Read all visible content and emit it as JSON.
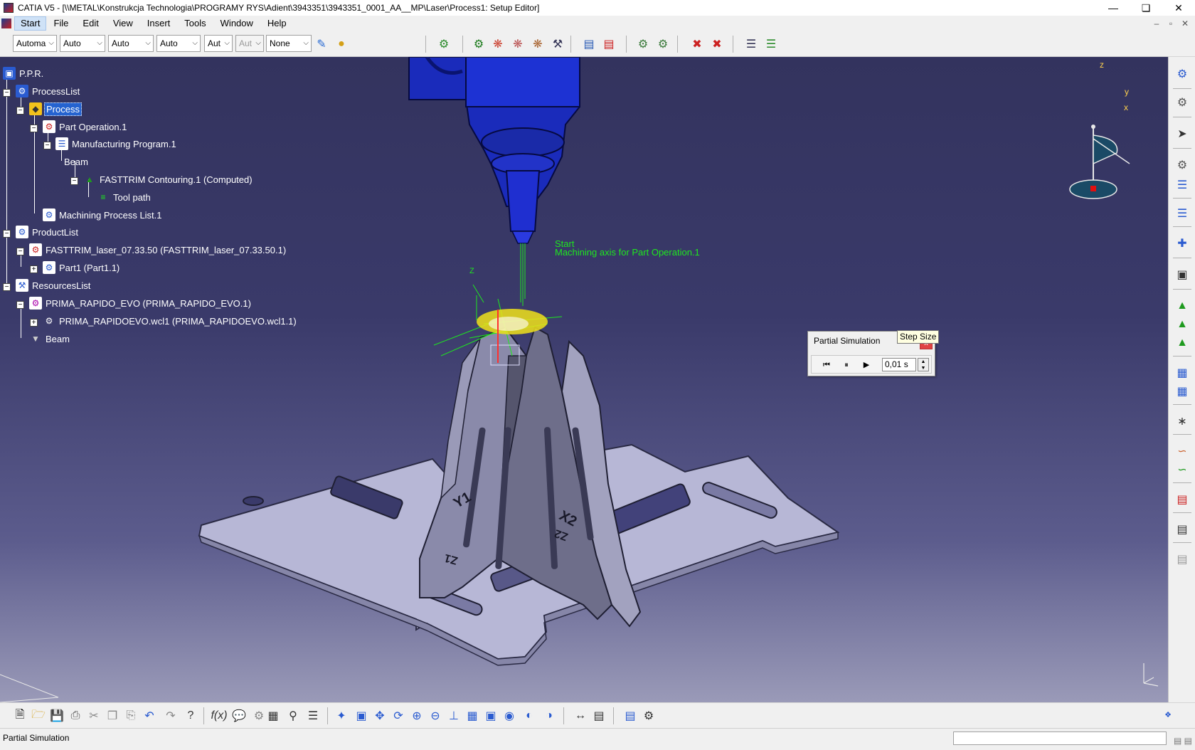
{
  "window": {
    "title": "CATIA V5 - [\\\\METAL\\Konstrukcja Technologia\\PROGRAMY RYS\\Adient\\3943351\\3943351_0001_AA__MP\\Laser\\Process1: Setup Editor]",
    "minimize": "—",
    "restore": "❏",
    "close": "✕"
  },
  "menu": {
    "items": [
      "Start",
      "File",
      "Edit",
      "View",
      "Insert",
      "Tools",
      "Window",
      "Help"
    ],
    "mdi_minimize": "–",
    "mdi_restore": "▫",
    "mdi_close": "✕"
  },
  "toolbar": {
    "combos": [
      "Automa",
      "Auto",
      "Auto",
      "Auto",
      "Aut",
      "Aut",
      "None"
    ]
  },
  "tree": {
    "nodes": [
      {
        "label": "P.P.R.",
        "icon": "ppr-icon"
      },
      {
        "label": "ProcessList",
        "icon": "process-list-icon"
      },
      {
        "label": "Process",
        "icon": "process-icon",
        "selected": true
      },
      {
        "label": "Part Operation.1",
        "icon": "part-operation-icon"
      },
      {
        "label": "Manufacturing Program.1",
        "icon": "manufacturing-program-icon"
      },
      {
        "label": "Beam",
        "icon": "beam-icon"
      },
      {
        "label": "FASTTRIM Contouring.1 (Computed)",
        "icon": "contouring-operation-icon"
      },
      {
        "label": "Tool path",
        "icon": "tool-path-icon"
      },
      {
        "label": "Machining Process List.1",
        "icon": "machining-process-list-icon"
      },
      {
        "label": "ProductList",
        "icon": "product-list-icon"
      },
      {
        "label": "FASTTRIM_laser_07.33.50 (FASTTRIM_laser_07.33.50.1)",
        "icon": "product-icon"
      },
      {
        "label": "Part1 (Part1.1)",
        "icon": "part-icon"
      },
      {
        "label": "ResourcesList",
        "icon": "resources-list-icon"
      },
      {
        "label": "PRIMA_RAPIDO_EVO (PRIMA_RAPIDO_EVO.1)",
        "icon": "machine-icon"
      },
      {
        "label": "PRIMA_RAPIDOEVO.wcl1 (PRIMA_RAPIDOEVO.wcl1.1)",
        "icon": "machine-component-icon"
      },
      {
        "label": "Beam",
        "icon": "beam-tool-icon"
      }
    ]
  },
  "viewport": {
    "overlay_label": "Machining axis for Part Operation.1",
    "start_label": "Start",
    "part_labels": {
      "y1": "Y1",
      "x2": "X2",
      "z1": "Z1",
      "z2": "Z2"
    },
    "compass": {
      "z": "z",
      "y": "y",
      "x": "x"
    }
  },
  "sim_dialog": {
    "title": "Partial Simulation",
    "close": "x",
    "step_value": "0,01 s",
    "rewind": "⏮",
    "pause": "⏸",
    "play": "▶"
  },
  "tooltip": "Step Size",
  "status": {
    "text": "Partial Simulation"
  },
  "colors": {
    "background_top": "#33335e",
    "background_bottom": "#9a9ab8",
    "selection": "#2563d0",
    "toolpath": "#1ee81e"
  }
}
